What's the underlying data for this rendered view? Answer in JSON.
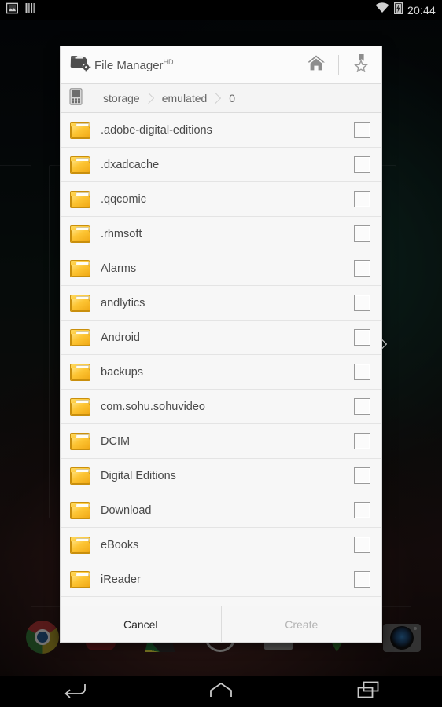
{
  "statusbar": {
    "left_icons": [
      "screenshot-icon",
      "equalizer-icon"
    ],
    "right_icons": [
      "wifi-icon",
      "battery-charging-icon"
    ],
    "clock": "20:44"
  },
  "dialog": {
    "title": "File Manager",
    "title_superscript": "HD",
    "app_icon": "folder-gear-icon",
    "actions": [
      {
        "name": "home-button",
        "icon": "home-icon"
      },
      {
        "name": "bookmark-button",
        "icon": "bookmark-star-icon"
      }
    ],
    "breadcrumb": {
      "device_icon": "device-storage-icon",
      "segments": [
        "storage",
        "emulated",
        "0"
      ]
    },
    "files": [
      {
        "name": ".adobe-digital-editions",
        "icon": "folder-icon",
        "checked": false
      },
      {
        "name": ".dxadcache",
        "icon": "folder-icon",
        "checked": false
      },
      {
        "name": ".qqcomic",
        "icon": "folder-icon",
        "checked": false
      },
      {
        "name": ".rhmsoft",
        "icon": "folder-icon",
        "checked": false
      },
      {
        "name": "Alarms",
        "icon": "folder-icon",
        "checked": false
      },
      {
        "name": "andlytics",
        "icon": "folder-icon",
        "checked": false
      },
      {
        "name": "Android",
        "icon": "folder-icon",
        "checked": false
      },
      {
        "name": "backups",
        "icon": "folder-icon",
        "checked": false
      },
      {
        "name": "com.sohu.sohuvideo",
        "icon": "folder-icon",
        "checked": false
      },
      {
        "name": "DCIM",
        "icon": "folder-icon",
        "checked": false
      },
      {
        "name": "Digital Editions",
        "icon": "folder-icon",
        "checked": false
      },
      {
        "name": "Download",
        "icon": "folder-icon",
        "checked": false
      },
      {
        "name": "eBooks",
        "icon": "folder-icon",
        "checked": false
      },
      {
        "name": "iReader",
        "icon": "folder-icon",
        "checked": false
      }
    ],
    "buttons": {
      "cancel": "Cancel",
      "create": "Create",
      "create_enabled": false
    }
  },
  "dock": {
    "items": [
      {
        "name": "chrome-icon",
        "shape": "chrome"
      },
      {
        "name": "app-icon-red",
        "shape": "dk-red"
      },
      {
        "name": "app-icon-fan",
        "shape": "dk-fan"
      },
      {
        "name": "app-icon-circle",
        "shape": "dk-circle"
      },
      {
        "name": "app-icon-gray",
        "shape": "dk-gray"
      },
      {
        "name": "app-icon-green",
        "shape": "dk-green"
      },
      {
        "name": "camera-icon",
        "shape": "camera"
      }
    ]
  },
  "navbar": {
    "buttons": [
      {
        "name": "back-button",
        "icon": "back-arrow-icon"
      },
      {
        "name": "home-button",
        "icon": "home-outline-icon"
      },
      {
        "name": "recents-button",
        "icon": "recents-icon"
      }
    ]
  },
  "colors": {
    "dialog_bg": "#f7f7f7",
    "folder_accent": "#fcc12b",
    "text_primary": "#4a4a4a",
    "text_disabled": "#b4b4b4",
    "status_bar": "#000000"
  }
}
